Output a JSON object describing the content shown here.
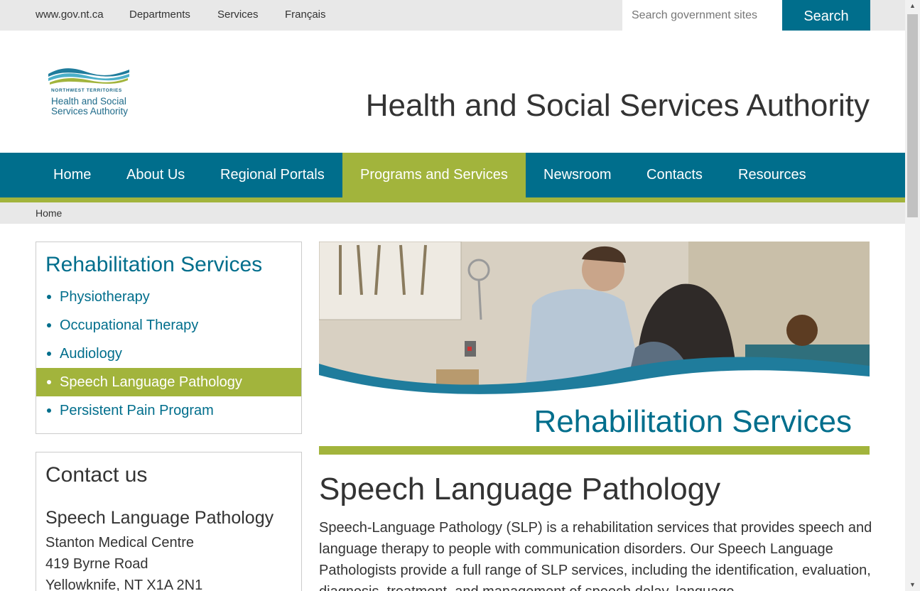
{
  "utility_bar": {
    "links": [
      "www.gov.nt.ca",
      "Departments",
      "Services",
      "Français"
    ],
    "search_placeholder": "Search government sites",
    "search_button": "Search"
  },
  "header": {
    "logo": {
      "small_text": "NORTHWEST TERRITORIES",
      "line1": "Health and Social",
      "line2": "Services Authority"
    },
    "site_title": "Health and Social Services Authority"
  },
  "nav": {
    "items": [
      "Home",
      "About Us",
      "Regional Portals",
      "Programs and Services",
      "Newsroom",
      "Contacts",
      "Resources"
    ],
    "active": "Programs and Services"
  },
  "breadcrumb": {
    "items": [
      "Home"
    ]
  },
  "sidebar": {
    "heading": "Rehabilitation Services",
    "items": [
      "Physiotherapy",
      "Occupational Therapy",
      "Audiology",
      "Speech Language Pathology",
      "Persistent Pain Program"
    ],
    "active": "Speech Language Pathology"
  },
  "contact": {
    "heading": "Contact us",
    "subheading": "Speech Language Pathology",
    "lines": [
      "Stanton Medical Centre",
      "419 Byrne Road",
      "Yellowknife, NT X1A 2N1"
    ]
  },
  "banner": {
    "title": "Rehabilitation Services"
  },
  "content": {
    "title": "Speech Language Pathology",
    "paragraph": "Speech-Language Pathology (SLP) is a rehabilitation services that provides speech and language therapy to people with communication disorders.   Our Speech Language Pathologists provide a full range of SLP services, including the identification, evaluation, diagnosis, treatment, and management of speech delay, language"
  },
  "colors": {
    "brand_teal": "#006e8c",
    "accent_green": "#a2b43c",
    "utility_gray": "#e8e8e8"
  },
  "icons": {
    "scroll_up": "▲",
    "scroll_down": "▼"
  }
}
